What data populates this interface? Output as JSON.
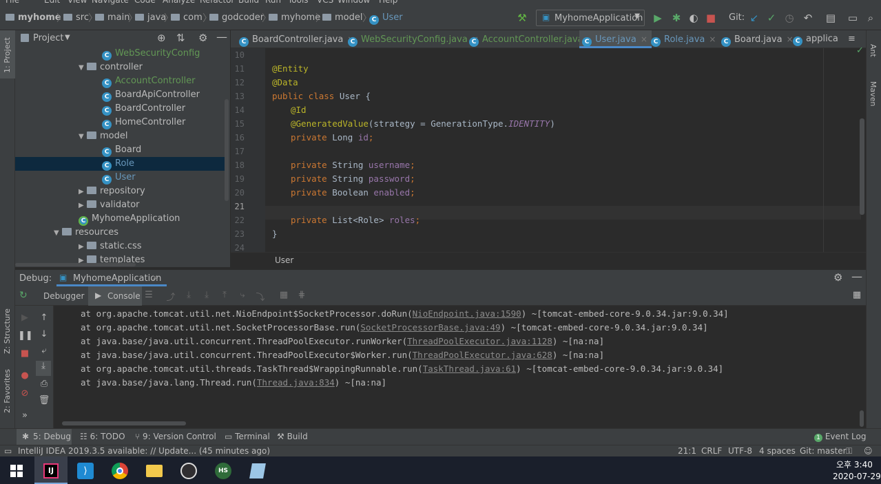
{
  "menu": [
    "File",
    "Edit",
    "View",
    "Navigate",
    "Code",
    "Analyze",
    "Refactor",
    "Build",
    "Run",
    "Tools",
    "VCS",
    "Window",
    "Help"
  ],
  "navbar": {
    "breadcrumbs": [
      "myhome",
      "src",
      "main",
      "java",
      "com",
      "godcoder",
      "myhome",
      "model",
      "User"
    ],
    "run_config": "MyhomeApplication",
    "git_label": "Git:"
  },
  "project": {
    "title": "Project",
    "tree": [
      {
        "label": "WebSecurityConfig",
        "kind": "class",
        "level": 3,
        "color": "#629755"
      },
      {
        "label": "controller",
        "kind": "folder",
        "level": 2,
        "open": true
      },
      {
        "label": "AccountController",
        "kind": "class",
        "level": 3,
        "color": "#629755"
      },
      {
        "label": "BoardApiController",
        "kind": "class",
        "level": 3,
        "color": "#bbbbbb"
      },
      {
        "label": "BoardController",
        "kind": "class",
        "level": 3,
        "color": "#bbbbbb"
      },
      {
        "label": "HomeController",
        "kind": "class",
        "level": 3,
        "color": "#bbbbbb"
      },
      {
        "label": "model",
        "kind": "folder",
        "level": 2,
        "open": true
      },
      {
        "label": "Board",
        "kind": "class",
        "level": 3,
        "color": "#bbbbbb"
      },
      {
        "label": "Role",
        "kind": "class",
        "level": 3,
        "color": "#6897bb",
        "selected": true
      },
      {
        "label": "User",
        "kind": "class",
        "level": 3,
        "color": "#6897bb"
      },
      {
        "label": "repository",
        "kind": "folder",
        "level": 2,
        "open": false
      },
      {
        "label": "validator",
        "kind": "folder",
        "level": 2,
        "open": false
      },
      {
        "label": "MyhomeApplication",
        "kind": "app",
        "level": 2,
        "color": "#bbbbbb"
      },
      {
        "label": "resources",
        "kind": "folder",
        "level": 1,
        "open": true
      },
      {
        "label": "static.css",
        "kind": "folder",
        "level": 2,
        "open": false
      },
      {
        "label": "templates",
        "kind": "folder",
        "level": 2,
        "open": false
      }
    ]
  },
  "editor": {
    "tabs": [
      {
        "label": "BoardController.java",
        "color": "#bbbbbb"
      },
      {
        "label": "WebSecurityConfig.java",
        "color": "#629755"
      },
      {
        "label": "AccountController.java",
        "color": "#629755"
      },
      {
        "label": "User.java",
        "color": "#6897bb",
        "active": true
      },
      {
        "label": "Role.java",
        "color": "#6897bb"
      },
      {
        "label": "Board.java",
        "color": "#bbbbbb"
      },
      {
        "label": "applica",
        "color": "#bbbbbb"
      }
    ],
    "line_numbers": [
      "10",
      "11",
      "12",
      "13",
      "14",
      "15",
      "16",
      "17",
      "18",
      "19",
      "20",
      "21",
      "22",
      "23",
      "24"
    ],
    "code": {
      "l11": "@Entity",
      "l12": "@Data",
      "l13_kw": "public class",
      "l13_rest": " User {",
      "l14": "@Id",
      "l15_ann": "@GeneratedValue",
      "l15_a": "(strategy = GenerationType.",
      "l15_b": "IDENTITY",
      "l15_c": ")",
      "l16_kw": "private",
      "l16_t": " Long ",
      "l16_f": "id",
      "l16_e": ";",
      "l18_kw": "private",
      "l18_t": " String ",
      "l18_f": "username",
      "l18_e": ";",
      "l19_kw": "private",
      "l19_t": " String ",
      "l19_f": "password",
      "l19_e": ";",
      "l20_kw": "private",
      "l20_t": " Boolean ",
      "l20_f": "enabled",
      "l20_e": ";",
      "l22_kw": "private",
      "l22_t": " List<Role> ",
      "l22_f": "roles",
      "l22_e": ";",
      "l23": "}"
    },
    "breadcrumb": "User"
  },
  "debug": {
    "label": "Debug:",
    "session": "MyhomeApplication",
    "tab_debugger": "Debugger",
    "tab_console": "Console",
    "console": [
      {
        "pre": "at org.apache.tomcat.util.net.NioEndpoint$SocketProcessor.doRun(",
        "link": "NioEndpoint.java:1590",
        "post": ") ~[tomcat-embed-core-9.0.34.jar:9.0.34]"
      },
      {
        "pre": "at org.apache.tomcat.util.net.SocketProcessorBase.run(",
        "link": "SocketProcessorBase.java:49",
        "post": ") ~[tomcat-embed-core-9.0.34.jar:9.0.34]"
      },
      {
        "pre": "at java.base/java.util.concurrent.ThreadPoolExecutor.runWorker(",
        "link": "ThreadPoolExecutor.java:1128",
        "post": ") ~[na:na]"
      },
      {
        "pre": "at java.base/java.util.concurrent.ThreadPoolExecutor$Worker.run(",
        "link": "ThreadPoolExecutor.java:628",
        "post": ") ~[na:na]"
      },
      {
        "pre": "at org.apache.tomcat.util.threads.TaskThread$WrappingRunnable.run(",
        "link": "TaskThread.java:61",
        "post": ") ~[tomcat-embed-core-9.0.34.jar:9.0.34]"
      },
      {
        "pre": "at java.base/java.lang.Thread.run(",
        "link": "Thread.java:834",
        "post": ") ~[na:na]"
      }
    ]
  },
  "side": {
    "project": "1: Project",
    "structure": "Z: Structure",
    "favorites": "2: Favorites",
    "ant": "Ant",
    "maven": "Maven"
  },
  "bottom_tools": [
    {
      "label": "5: Debug"
    },
    {
      "label": "6: TODO"
    },
    {
      "label": "9: Version Control"
    },
    {
      "label": "Terminal"
    },
    {
      "label": "Build"
    }
  ],
  "event_log": "Event Log",
  "event_count": "1",
  "status": {
    "message": "IntelliJ IDEA 2019.3.5 available: // Update... (45 minutes ago)",
    "position": "21:1",
    "line_sep": "CRLF",
    "encoding": "UTF-8",
    "indent": "4 spaces",
    "branch": "Git: master"
  },
  "taskbar": {
    "time": "오후 3:40",
    "date": "2020-07-29"
  }
}
